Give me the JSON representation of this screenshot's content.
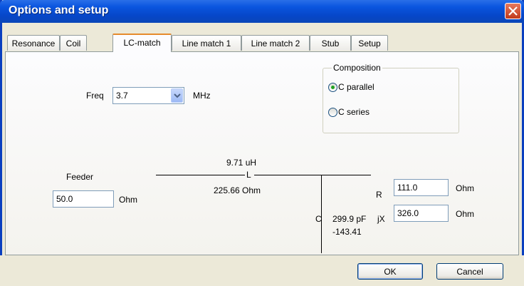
{
  "window": {
    "title": "Options and setup"
  },
  "tabs": [
    {
      "label": "Resonance"
    },
    {
      "label": "Coil"
    },
    {
      "label": "LC-match"
    },
    {
      "label": "Line match  1"
    },
    {
      "label": "Line match 2"
    },
    {
      "label": "Stub"
    },
    {
      "label": "Setup"
    }
  ],
  "active_tab": "LC-match",
  "freq": {
    "label": "Freq",
    "value": "3.7",
    "unit": "MHz"
  },
  "composition": {
    "title": "Composition",
    "options": [
      {
        "label": "C parallel",
        "selected": true
      },
      {
        "label": "C series",
        "selected": false
      }
    ]
  },
  "feeder": {
    "label": "Feeder",
    "value": "50.0",
    "unit": "Ohm"
  },
  "inductor": {
    "value": "9.71 uH",
    "symbol": "L",
    "reactance": "225.66 Ohm"
  },
  "capacitor": {
    "symbol": "C",
    "value": "299.9 pF",
    "reactance": "-143.41"
  },
  "load": {
    "r_label": "R",
    "r_value": "111.0",
    "r_unit": "Ohm",
    "x_label": "jX",
    "x_value": "326.0",
    "x_unit": "Ohm"
  },
  "buttons": {
    "ok": "OK",
    "cancel": "Cancel"
  },
  "colors": {
    "titlebar": "#0a55df",
    "active_tab_accent": "#e68b2c",
    "radio_dot": "#21a121",
    "close": "#c0391a"
  }
}
